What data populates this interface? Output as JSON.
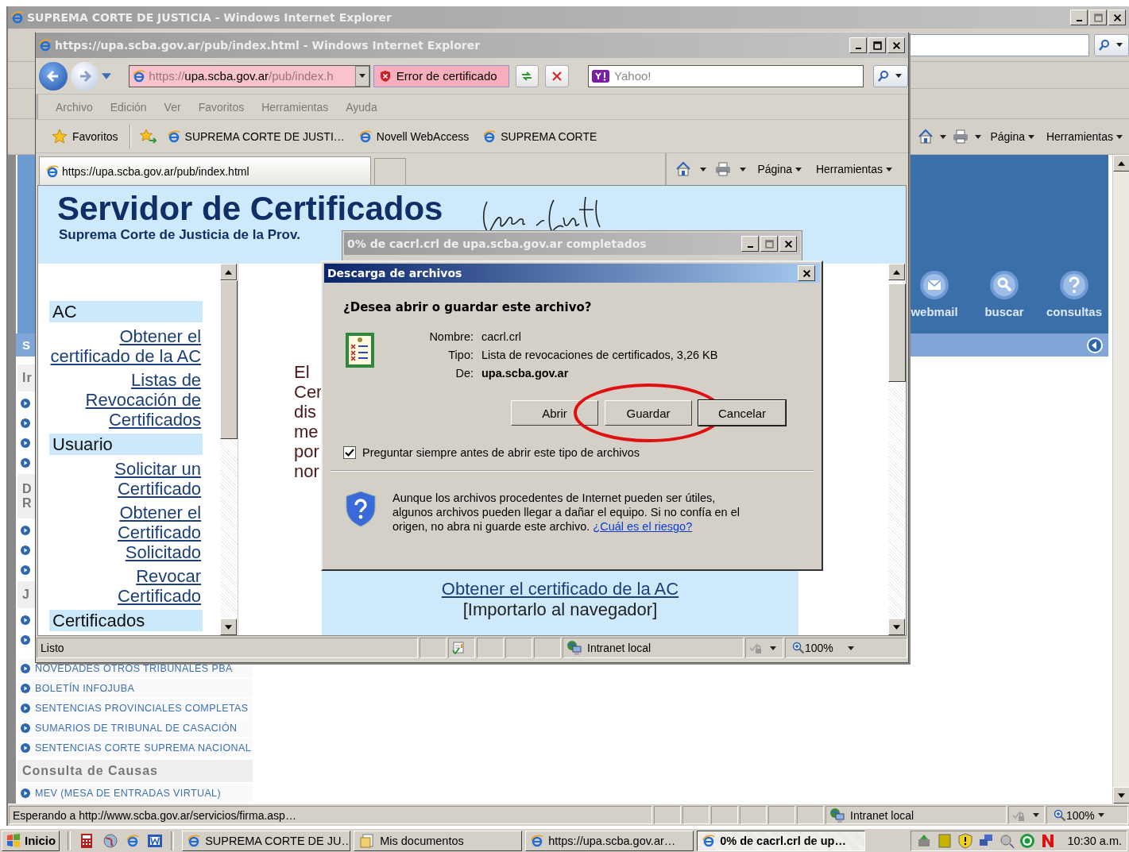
{
  "outer_window": {
    "title": "SUPREMA CORTE DE JUSTICIA - Windows Internet Explorer",
    "command_bar": [
      "Página",
      "Herramientas"
    ],
    "portal_nav": [
      {
        "kind": "mail",
        "label": "webmail"
      },
      {
        "kind": "search",
        "label": "buscar"
      },
      {
        "kind": "help",
        "label": "consultas"
      }
    ],
    "section_bar": "S",
    "sidebar": [
      {
        "kind": "heading",
        "label": "Ir"
      },
      {
        "kind": "link"
      },
      {
        "kind": "link"
      },
      {
        "kind": "link"
      },
      {
        "kind": "link"
      },
      {
        "kind": "heading",
        "label": "D\nR"
      },
      {
        "kind": "link"
      },
      {
        "kind": "link"
      },
      {
        "kind": "link"
      },
      {
        "kind": "heading",
        "label": "J"
      },
      {
        "kind": "link"
      },
      {
        "kind": "link"
      },
      {
        "kind": "link",
        "label": "NOVEDADES OTROS TRIBUNALES PBA"
      },
      {
        "kind": "link",
        "label": "BOLETÍN INFOJUBA"
      },
      {
        "kind": "link",
        "label": "SENTENCIAS PROVINCIALES COMPLETAS"
      },
      {
        "kind": "link",
        "label": "SUMARIOS DE TRIBUNAL DE CASACIÓN"
      },
      {
        "kind": "link",
        "label": "SENTENCIAS CORTE SUPREMA NACIONAL"
      },
      {
        "kind": "heading",
        "label": "Consulta de Causas"
      },
      {
        "kind": "link",
        "label": "MEV (MESA DE ENTRADAS VIRTUAL)"
      }
    ],
    "status_bar": {
      "text": "Esperando a http://www.scba.gov.ar/servicios/firma.asp…",
      "zone": "Intranet local",
      "zoom": "100%"
    }
  },
  "inner_window": {
    "title": "https://upa.scba.gov.ar/pub/index.html - Windows Internet Explorer",
    "address": {
      "scheme": "https://",
      "host": "upa.scba.gov.ar",
      "path": "/pub/index.h"
    },
    "certificate_error": "Error de certificado",
    "search": {
      "placeholder": "Yahoo!"
    },
    "menu": [
      "Archivo",
      "Edición",
      "Ver",
      "Favoritos",
      "Herramientas",
      "Ayuda"
    ],
    "favorites_bar": {
      "label": "Favoritos",
      "links": [
        "SUPREMA CORTE DE JUSTI…",
        "Novell WebAccess",
        "SUPREMA CORTE"
      ]
    },
    "tabs": [
      {
        "label": "https://upa.scba.gov.ar/pub/index.html",
        "selected": true
      }
    ],
    "command_bar": [
      "Página",
      "Herramientas"
    ],
    "page": {
      "title": "Servidor de Certificados",
      "subtitle": "Suprema Corte de Justicia de la Prov.",
      "nav": [
        {
          "kind": "heading",
          "label": "AC"
        },
        {
          "kind": "link",
          "label": "Obtener el certificado de la AC"
        },
        {
          "kind": "link",
          "label": "Listas de Revocación de Certificados"
        },
        {
          "kind": "heading",
          "label": "Usuario"
        },
        {
          "kind": "link",
          "label": "Solicitar un Certificado"
        },
        {
          "kind": "link",
          "label": "Obtener el Certificado Solicitado"
        },
        {
          "kind": "link",
          "label": "Revocar Certificado"
        },
        {
          "kind": "heading",
          "label": "Certificados"
        }
      ],
      "text_fragments": [
        "El",
        "Cer",
        "dis",
        "me",
        "por",
        "nor"
      ],
      "ca_link": "Obtener el certificado de la AC",
      "ca_note": "[Importarlo al navegador]"
    },
    "status_bar": {
      "text": "Listo",
      "zone": "Intranet local",
      "zoom": "100%"
    }
  },
  "progress_window": {
    "title": "0% de cacrl.crl de upa.scba.gov.ar completados"
  },
  "dialog": {
    "title": "Descarga de archivos",
    "question": "¿Desea abrir o guardar este archivo?",
    "fields": [
      {
        "label": "Nombre:",
        "value": "cacrl.crl",
        "bold": false
      },
      {
        "label": "Tipo:",
        "value": "Lista de revocaciones de certificados, 3,26 KB",
        "bold": false
      },
      {
        "label": "De:",
        "value": "upa.scba.gov.ar",
        "bold": true
      }
    ],
    "buttons": [
      {
        "label": "Abrir",
        "default": false,
        "highlighted": false
      },
      {
        "label": "Guardar",
        "default": false,
        "highlighted": true
      },
      {
        "label": "Cancelar",
        "default": true,
        "highlighted": false
      }
    ],
    "always_ask": {
      "label": "Preguntar siempre antes de abrir este tipo de archivos",
      "checked": true
    },
    "warning": "Aunque los archivos procedentes de Internet pueden ser útiles, algunos archivos pueden llegar a dañar el equipo. Si no confía en el origen, no abra ni guarde este archivo.",
    "risk_link": "¿Cuál es el riesgo?"
  },
  "taskbar": {
    "start": "Inicio",
    "tasks": [
      {
        "kind": "browser",
        "label": "SUPREMA CORTE DE JU…",
        "selected": false
      },
      {
        "kind": "folder",
        "label": "Mis documentos",
        "selected": false
      },
      {
        "kind": "browser",
        "label": "https://upa.scba.gov.ar…",
        "selected": false
      },
      {
        "kind": "browser",
        "label": "0% de cacrl.crl de up…",
        "selected": true
      }
    ],
    "clock": "10:30 a.m."
  }
}
